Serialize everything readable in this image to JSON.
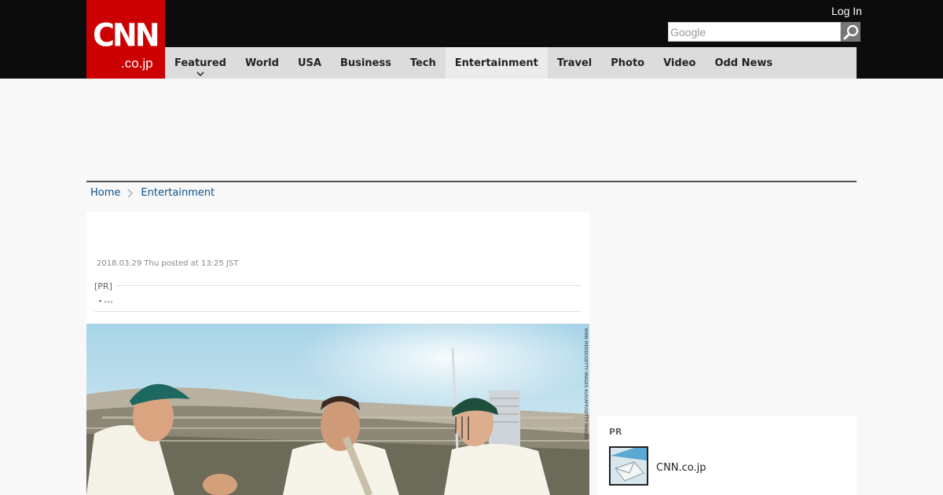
{
  "header": {
    "logo": {
      "mark": "CNN",
      "sub": ".co.jp",
      "color": "#cc0000"
    },
    "login_label": "Log In",
    "search": {
      "placeholder": "Google",
      "icon": "search-icon"
    }
  },
  "nav": {
    "items": [
      {
        "label": "Featured"
      },
      {
        "label": "World"
      },
      {
        "label": "USA"
      },
      {
        "label": "Business"
      },
      {
        "label": "Tech"
      },
      {
        "label": "Entertainment"
      },
      {
        "label": "Travel"
      },
      {
        "label": "Photo"
      },
      {
        "label": "Video"
      },
      {
        "label": "Odd News"
      }
    ],
    "active": "Entertainment"
  },
  "breadcrumb": {
    "items": [
      {
        "label": "Home"
      },
      {
        "label": "Entertainment"
      }
    ]
  },
  "article": {
    "posted": "2018.03.29 Thu posted at 13:25 JST",
    "pr_label": "[PR]",
    "pr_bullet": "・",
    "pr_link": "…",
    "photo_credit": "RYAN PIERSE/GETTY IMAGES AUS/AFP/GETTY IMAGES"
  },
  "sidebar": {
    "pr_title": "PR",
    "pr_item": "CNN.co.jp"
  }
}
